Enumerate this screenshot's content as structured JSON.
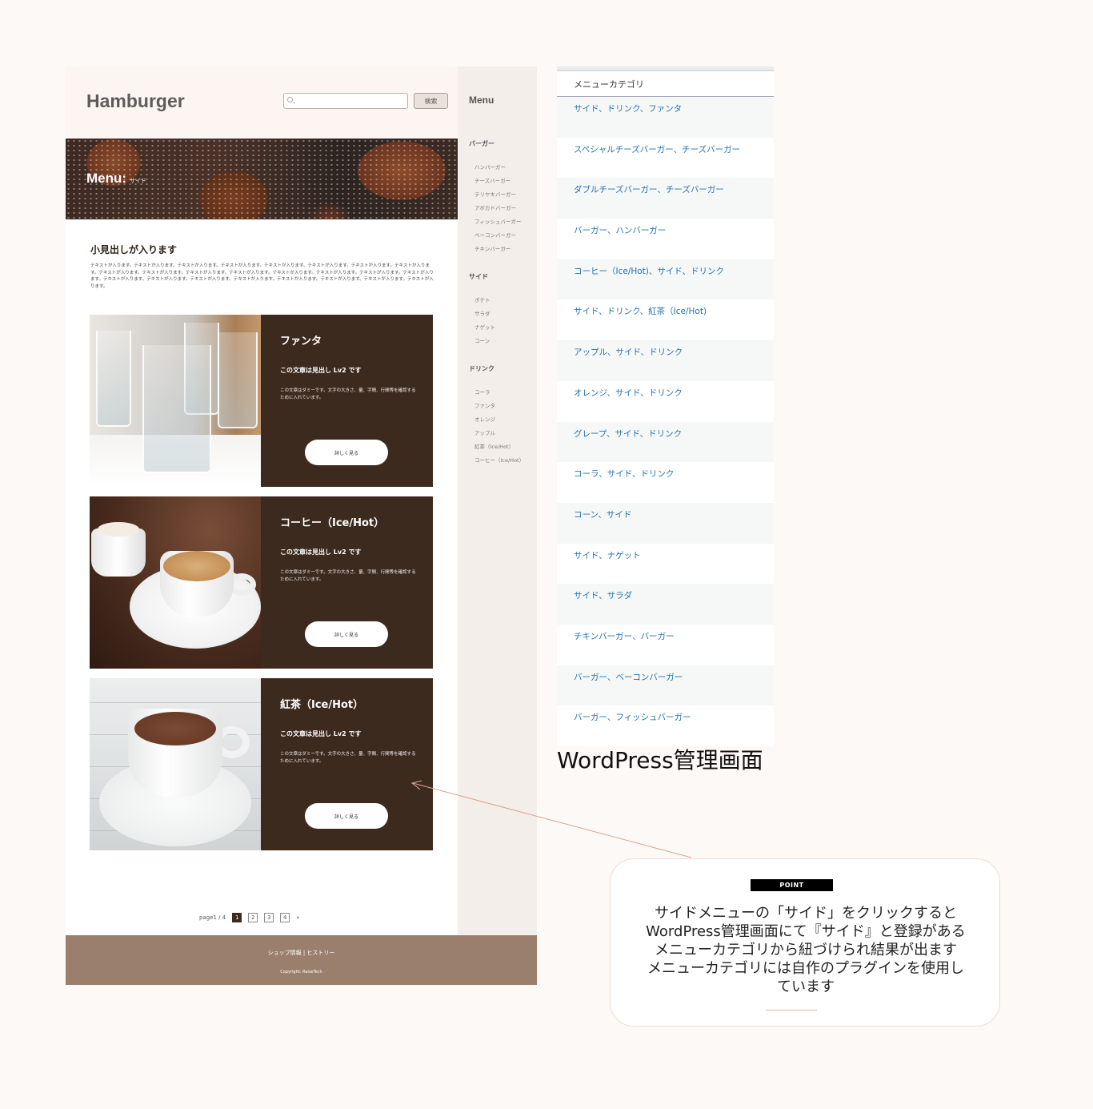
{
  "site": {
    "logo": "Hamburger",
    "search_placeholder": "",
    "search_button": "検索",
    "hero_title": "Menu:",
    "hero_subtitle": "サイド",
    "sub_heading": "小見出しが入ります",
    "lead_text": "テキストが入ります。テキストが入ります。テキストが入ります。テキストが入ります。テキストが入ります。テキストが入ります。テキストが入ります。テキストが入ります。テキストが入ります。テキストが入ります。テキストが入ります。テキストが入ります。テキストが入ります。テキストが入ります。テキストが入ります。テキストが入ります。テキストが入ります。テキストが入ります。テキストが入ります。テキストが入ります。テキストが入ります。テキストが入ります。テキストが入ります。テキストが入ります。",
    "cards": [
      {
        "title": "ファンタ",
        "heading": "この文章は見出し Lv2 です",
        "desc": "この文章はダミーです。文字の大きさ、量、字間、行間等を確認するために入れています。",
        "button": "詳しく見る"
      },
      {
        "title": "コーヒー（Ice/Hot）",
        "heading": "この文章は見出し Lv2 です",
        "desc": "この文章はダミーです。文字の大きさ、量、字間、行間等を確認するために入れています。",
        "button": "詳しく見る"
      },
      {
        "title": "紅茶（Ice/Hot）",
        "heading": "この文章は見出し Lv2 です",
        "desc": "この文章はダミーです。文字の大きさ、量、字間、行間等を確認するために入れています。",
        "button": "詳しく見る"
      }
    ],
    "pagination": {
      "label": "page1 / 4",
      "pages": [
        "1",
        "2",
        "3",
        "4"
      ],
      "current": "1",
      "next": "»"
    },
    "sidebar": {
      "title": "Menu",
      "categories": [
        {
          "name": "バーガー",
          "items": [
            "ハンバーガー",
            "チーズバーガー",
            "テリヤキバーガー",
            "アボカドバーガー",
            "フィッシュバーガー",
            "ベーコンバーガー",
            "チキンバーガー"
          ]
        },
        {
          "name": "サイド",
          "items": [
            "ポテト",
            "サラダ",
            "ナゲット",
            "コーン"
          ]
        },
        {
          "name": "ドリンク",
          "items": [
            "コーラ",
            "ファンタ",
            "オレンジ",
            "アップル",
            "紅茶（Ice/Hot）",
            "コーヒー（Ice/Hot）"
          ]
        }
      ]
    },
    "footer": {
      "links": "ショップ情報 | ヒストリー",
      "copyright": "Copyright: RaiseTech"
    }
  },
  "wp_admin": {
    "column_header": "メニューカテゴリ",
    "rows": [
      "サイド、ドリンク、ファンタ",
      "スペシャルチーズバーガー、チーズバーガー",
      "ダブルチーズバーガー、チーズバーガー",
      "バーガー、ハンバーガー",
      "コーヒー（Ice/Hot)、サイド、ドリンク",
      "サイド、ドリンク、紅茶（Ice/Hot)",
      "アップル、サイド、ドリンク",
      "オレンジ、サイド、ドリンク",
      "グレープ、サイド、ドリンク",
      "コーラ、サイド、ドリンク",
      "コーン、サイド",
      "サイド、ナゲット",
      "サイド、サラダ",
      "チキンバーガー、バーガー",
      "バーガー、ベーコンバーガー",
      "バーガー、フィッシュバーガー"
    ],
    "caption": "WordPress管理画面",
    "link_color": "#2271b1"
  },
  "callout": {
    "badge": "POINT",
    "lines": [
      "サイドメニューの「サイド」をクリックすると",
      "WordPress管理画面にて『サイド』と登録がある",
      "メニューカテゴリから紐づけられ結果が出ます",
      "メニューカテゴリには自作のプラグインを使用し",
      "ています"
    ]
  },
  "colors": {
    "card_bg": "#3d2a1f",
    "footer_bg": "#9a806c",
    "sidebar_bg": "#f3eeea",
    "header_bg": "#fdf5f1",
    "page_bg": "#fdf9f6"
  }
}
